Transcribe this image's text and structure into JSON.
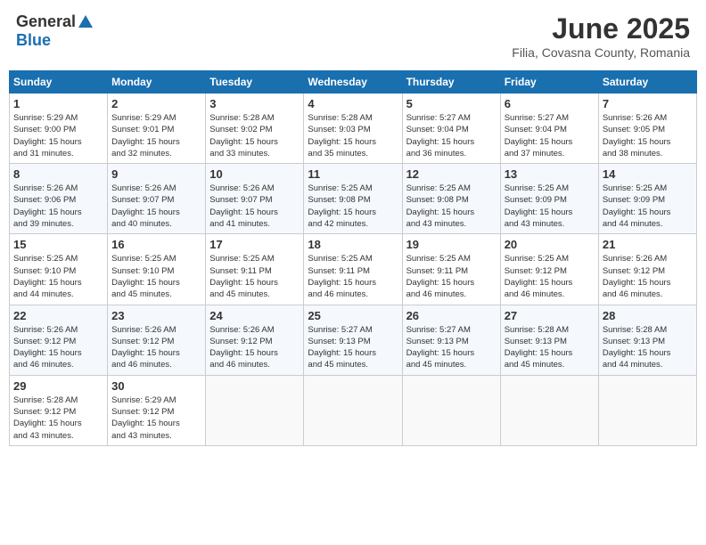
{
  "header": {
    "logo_general": "General",
    "logo_blue": "Blue",
    "month_title": "June 2025",
    "location": "Filia, Covasna County, Romania"
  },
  "weekdays": [
    "Sunday",
    "Monday",
    "Tuesday",
    "Wednesday",
    "Thursday",
    "Friday",
    "Saturday"
  ],
  "weeks": [
    [
      {
        "day": "1",
        "info": "Sunrise: 5:29 AM\nSunset: 9:00 PM\nDaylight: 15 hours\nand 31 minutes."
      },
      {
        "day": "2",
        "info": "Sunrise: 5:29 AM\nSunset: 9:01 PM\nDaylight: 15 hours\nand 32 minutes."
      },
      {
        "day": "3",
        "info": "Sunrise: 5:28 AM\nSunset: 9:02 PM\nDaylight: 15 hours\nand 33 minutes."
      },
      {
        "day": "4",
        "info": "Sunrise: 5:28 AM\nSunset: 9:03 PM\nDaylight: 15 hours\nand 35 minutes."
      },
      {
        "day": "5",
        "info": "Sunrise: 5:27 AM\nSunset: 9:04 PM\nDaylight: 15 hours\nand 36 minutes."
      },
      {
        "day": "6",
        "info": "Sunrise: 5:27 AM\nSunset: 9:04 PM\nDaylight: 15 hours\nand 37 minutes."
      },
      {
        "day": "7",
        "info": "Sunrise: 5:26 AM\nSunset: 9:05 PM\nDaylight: 15 hours\nand 38 minutes."
      }
    ],
    [
      {
        "day": "8",
        "info": "Sunrise: 5:26 AM\nSunset: 9:06 PM\nDaylight: 15 hours\nand 39 minutes."
      },
      {
        "day": "9",
        "info": "Sunrise: 5:26 AM\nSunset: 9:07 PM\nDaylight: 15 hours\nand 40 minutes."
      },
      {
        "day": "10",
        "info": "Sunrise: 5:26 AM\nSunset: 9:07 PM\nDaylight: 15 hours\nand 41 minutes."
      },
      {
        "day": "11",
        "info": "Sunrise: 5:25 AM\nSunset: 9:08 PM\nDaylight: 15 hours\nand 42 minutes."
      },
      {
        "day": "12",
        "info": "Sunrise: 5:25 AM\nSunset: 9:08 PM\nDaylight: 15 hours\nand 43 minutes."
      },
      {
        "day": "13",
        "info": "Sunrise: 5:25 AM\nSunset: 9:09 PM\nDaylight: 15 hours\nand 43 minutes."
      },
      {
        "day": "14",
        "info": "Sunrise: 5:25 AM\nSunset: 9:09 PM\nDaylight: 15 hours\nand 44 minutes."
      }
    ],
    [
      {
        "day": "15",
        "info": "Sunrise: 5:25 AM\nSunset: 9:10 PM\nDaylight: 15 hours\nand 44 minutes."
      },
      {
        "day": "16",
        "info": "Sunrise: 5:25 AM\nSunset: 9:10 PM\nDaylight: 15 hours\nand 45 minutes."
      },
      {
        "day": "17",
        "info": "Sunrise: 5:25 AM\nSunset: 9:11 PM\nDaylight: 15 hours\nand 45 minutes."
      },
      {
        "day": "18",
        "info": "Sunrise: 5:25 AM\nSunset: 9:11 PM\nDaylight: 15 hours\nand 46 minutes."
      },
      {
        "day": "19",
        "info": "Sunrise: 5:25 AM\nSunset: 9:11 PM\nDaylight: 15 hours\nand 46 minutes."
      },
      {
        "day": "20",
        "info": "Sunrise: 5:25 AM\nSunset: 9:12 PM\nDaylight: 15 hours\nand 46 minutes."
      },
      {
        "day": "21",
        "info": "Sunrise: 5:26 AM\nSunset: 9:12 PM\nDaylight: 15 hours\nand 46 minutes."
      }
    ],
    [
      {
        "day": "22",
        "info": "Sunrise: 5:26 AM\nSunset: 9:12 PM\nDaylight: 15 hours\nand 46 minutes."
      },
      {
        "day": "23",
        "info": "Sunrise: 5:26 AM\nSunset: 9:12 PM\nDaylight: 15 hours\nand 46 minutes."
      },
      {
        "day": "24",
        "info": "Sunrise: 5:26 AM\nSunset: 9:12 PM\nDaylight: 15 hours\nand 46 minutes."
      },
      {
        "day": "25",
        "info": "Sunrise: 5:27 AM\nSunset: 9:13 PM\nDaylight: 15 hours\nand 45 minutes."
      },
      {
        "day": "26",
        "info": "Sunrise: 5:27 AM\nSunset: 9:13 PM\nDaylight: 15 hours\nand 45 minutes."
      },
      {
        "day": "27",
        "info": "Sunrise: 5:28 AM\nSunset: 9:13 PM\nDaylight: 15 hours\nand 45 minutes."
      },
      {
        "day": "28",
        "info": "Sunrise: 5:28 AM\nSunset: 9:13 PM\nDaylight: 15 hours\nand 44 minutes."
      }
    ],
    [
      {
        "day": "29",
        "info": "Sunrise: 5:28 AM\nSunset: 9:12 PM\nDaylight: 15 hours\nand 43 minutes."
      },
      {
        "day": "30",
        "info": "Sunrise: 5:29 AM\nSunset: 9:12 PM\nDaylight: 15 hours\nand 43 minutes."
      },
      {
        "day": "",
        "info": ""
      },
      {
        "day": "",
        "info": ""
      },
      {
        "day": "",
        "info": ""
      },
      {
        "day": "",
        "info": ""
      },
      {
        "day": "",
        "info": ""
      }
    ]
  ]
}
